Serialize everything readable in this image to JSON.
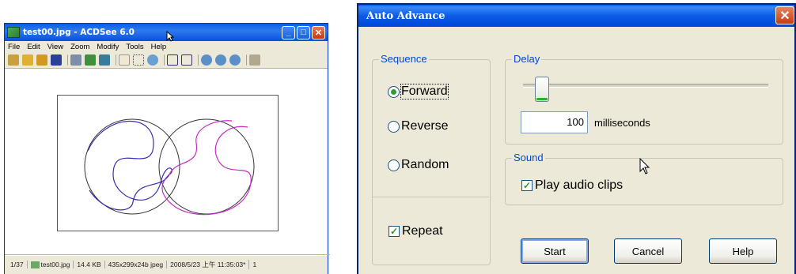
{
  "acdsee": {
    "title": "test00.jpg - ACDSee 6.0",
    "menu": [
      "File",
      "Edit",
      "View",
      "Zoom",
      "Modify",
      "Tools",
      "Help"
    ],
    "status": {
      "index": "1/37",
      "filename": "test00.jpg",
      "size": "14.4 KB",
      "dims": "435x299x24b jpeg",
      "date": "2008/5/23 上午 11:35:03*",
      "zoom": "1"
    }
  },
  "dialog": {
    "title": "Auto Advance",
    "sequence": {
      "label": "Sequence",
      "options": [
        "Forward",
        "Reverse",
        "Random"
      ],
      "selected": "Forward"
    },
    "repeat": {
      "label": "Repeat",
      "checked": true
    },
    "delay": {
      "label": "Delay",
      "value": "100",
      "unit": "milliseconds",
      "slider_fraction": 0.05
    },
    "sound": {
      "label": "Sound",
      "play_audio": {
        "label": "Play audio clips",
        "checked": true
      }
    },
    "buttons": {
      "start": "Start",
      "cancel": "Cancel",
      "help": "Help"
    }
  },
  "colors": {
    "titlebar": "#0a5fe6",
    "dialog_bg": "#ece9d8",
    "group_label": "#0046d5",
    "curve_blue": "#3a2fb0",
    "curve_magenta": "#c42bc4"
  }
}
